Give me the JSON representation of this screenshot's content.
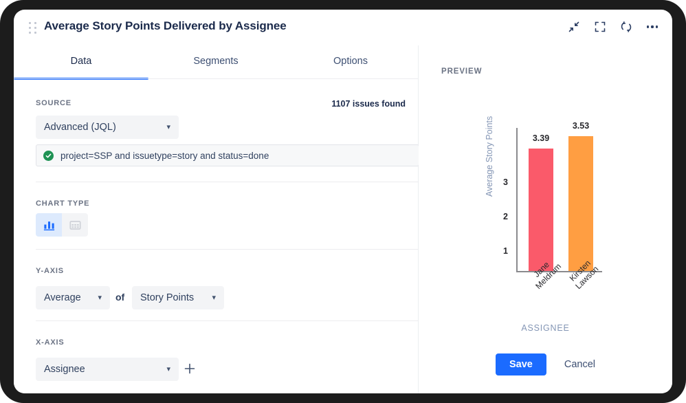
{
  "window": {
    "title": "Average Story Points Delivered by Assignee",
    "icons": [
      {
        "name": "collapse-icon",
        "glyph": "collapse"
      },
      {
        "name": "fullscreen-icon",
        "glyph": "fullscreen"
      },
      {
        "name": "refresh-icon",
        "glyph": "refresh"
      },
      {
        "name": "more-options-icon",
        "glyph": "ellipsis"
      }
    ]
  },
  "tabs": [
    {
      "label": "Data",
      "active": true
    },
    {
      "label": "Segments",
      "active": false
    },
    {
      "label": "Options",
      "active": false
    }
  ],
  "source": {
    "label": "SOURCE",
    "issues_found": "1107 issues found",
    "type_value": "Advanced (JQL)",
    "query": "project=SSP and issuetype=story and status=done",
    "query_valid": true
  },
  "chart_type": {
    "label": "CHART TYPE",
    "options": [
      {
        "name": "bar-chart-icon",
        "selected": true
      },
      {
        "name": "table-icon",
        "selected": false
      }
    ]
  },
  "y_axis": {
    "label": "Y-AXIS",
    "aggregation": "Average",
    "connector": "of",
    "field": "Story Points"
  },
  "x_axis": {
    "label": "X-AXIS",
    "field": "Assignee",
    "add_label": "+"
  },
  "preview": {
    "label": "PREVIEW",
    "save_label": "Save",
    "cancel_label": "Cancel"
  },
  "colors": {
    "accent": "#1b6bff",
    "title": "#1b2a4b",
    "bar_1": "#fa5a6a",
    "bar_2": "#ff9e42",
    "axis_label": "#8496b5",
    "valid_green": "#1f9254"
  },
  "chart_data": {
    "type": "bar",
    "title": "",
    "categories": [
      "Jane Meldrum",
      "Kirsten Lawson"
    ],
    "values": [
      3.39,
      3.53
    ],
    "value_labels": [
      "3.39",
      "3.53"
    ],
    "colors": [
      "#fa5a6a",
      "#ff9e42"
    ],
    "xlabel": "ASSIGNEE",
    "ylabel": "Average Story Points",
    "yticks": [
      "1",
      "2",
      "3"
    ],
    "ytick_values": [
      1,
      2,
      3
    ],
    "ylim": [
      0,
      3.8
    ],
    "grid": false,
    "legend": false
  }
}
